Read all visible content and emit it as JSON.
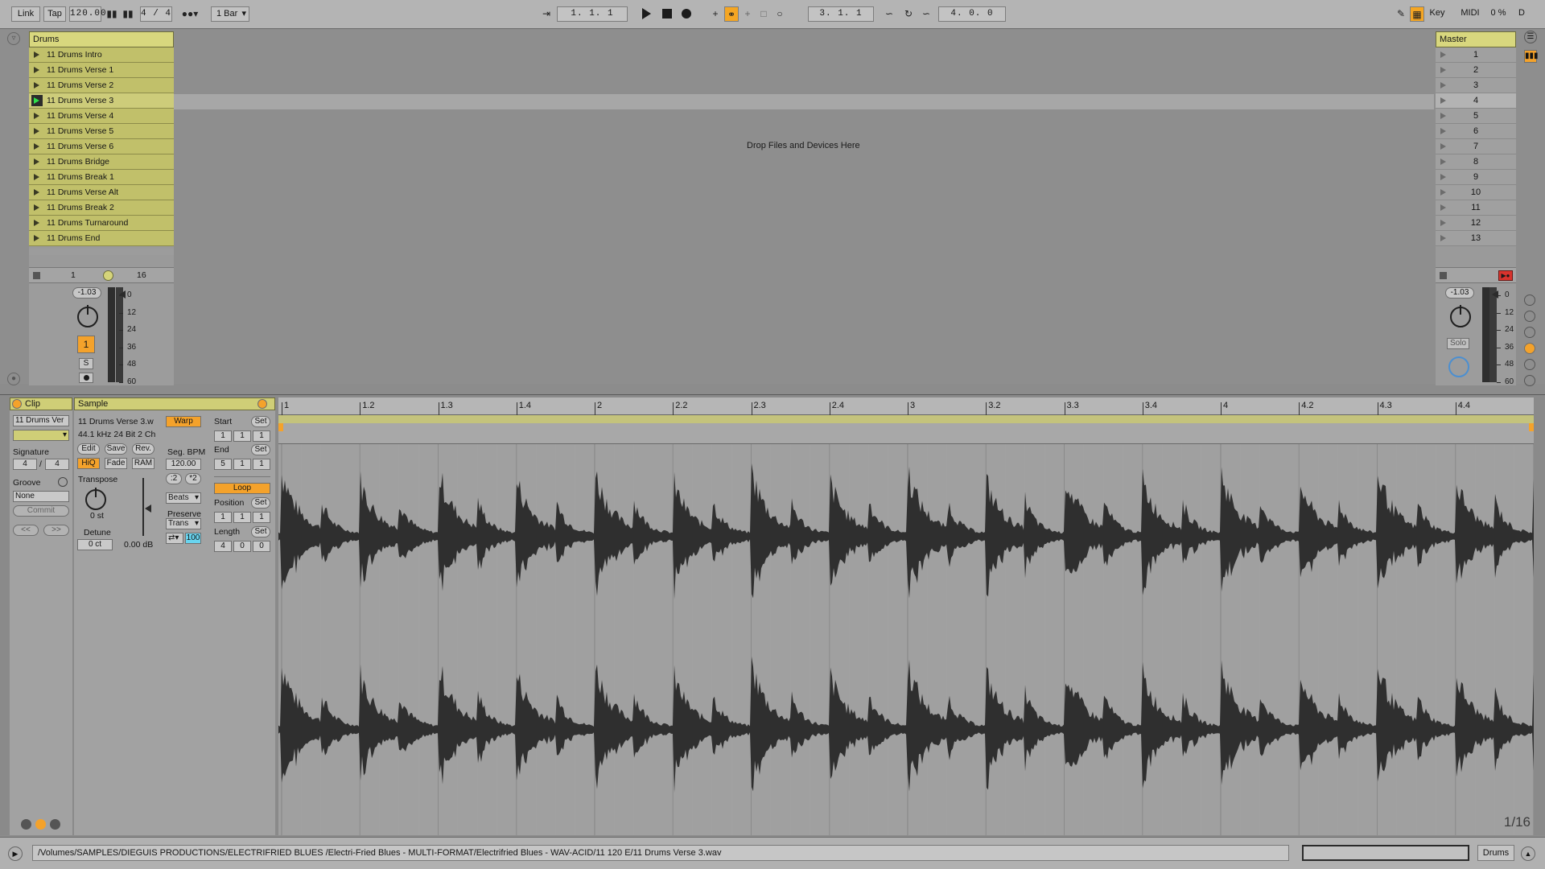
{
  "topbar": {
    "link": "Link",
    "tap": "Tap",
    "tempo": "120.00",
    "time_signature": "4 / 4",
    "quantization": "1 Bar",
    "arrangement_position": "1.  1.  1",
    "loop_start": "3.  1.  1",
    "loop_length": "4.  0.  0",
    "key": "Key",
    "midi": "MIDI",
    "cpu": "0 %",
    "disk": "D"
  },
  "session": {
    "drop_text": "Drop Files and Devices Here",
    "track": {
      "name": "Drums",
      "clips": [
        "11 Drums Intro",
        "11 Drums Verse 1",
        "11 Drums Verse 2",
        "11 Drums Verse 3",
        "11 Drums Verse 4",
        "11 Drums Verse 5",
        "11 Drums Verse 6",
        "11 Drums Bridge",
        "11 Drums Break 1",
        "11 Drums Verse Alt",
        "11 Drums Break 2",
        "11 Drums Turnaround",
        "11 Drums End"
      ],
      "playing_index": 3,
      "io_left": "1",
      "io_right": "16",
      "volume": "-1.03",
      "track_number": "1",
      "solo": "S",
      "meter_scale": [
        "0",
        "12",
        "24",
        "36",
        "48",
        "60"
      ]
    },
    "master": {
      "name": "Master",
      "scenes": [
        "1",
        "2",
        "3",
        "4",
        "5",
        "6",
        "7",
        "8",
        "9",
        "10",
        "11",
        "12",
        "13"
      ],
      "selected_scene_index": 3,
      "volume": "-1.03",
      "solo": "Solo",
      "meter_scale": [
        "0",
        "12",
        "24",
        "36",
        "48",
        "60"
      ]
    }
  },
  "clip_panel": {
    "header": "Clip",
    "clip_name": "11 Drums Ver",
    "signature_label": "Signature",
    "sig_num": "4",
    "sig_sep": "/",
    "sig_den": "4",
    "groove_label": "Groove",
    "groove_value": "None",
    "commit": "Commit",
    "prev": "<<",
    "next": ">>"
  },
  "sample_panel": {
    "header": "Sample",
    "file_name": "11 Drums Verse 3.w",
    "file_info": "44.1 kHz 24 Bit 2 Ch",
    "edit": "Edit",
    "save": "Save",
    "rev": "Rev.",
    "hiq": "HiQ",
    "fade": "Fade",
    "ram": "RAM",
    "transpose_label": "Transpose",
    "transpose_value": "0 st",
    "detune_label": "Detune",
    "detune_value": "0 ct",
    "gain_value": "0.00 dB",
    "warp": "Warp",
    "seg_bpm_label": "Seg. BPM",
    "seg_bpm": "120.00",
    "half": ":2",
    "double": "*2",
    "warp_mode": "Beats",
    "preserve_label": "Preserve",
    "preserve_value": "Trans",
    "loop_value": "100",
    "start_label": "Start",
    "start_set": "Set",
    "start_values": [
      "1",
      "1",
      "1"
    ],
    "end_label": "End",
    "end_set": "Set",
    "end_values": [
      "5",
      "1",
      "1"
    ],
    "loop": "Loop",
    "position_label": "Position",
    "position_set": "Set",
    "position_values": [
      "1",
      "1",
      "1"
    ],
    "length_label": "Length",
    "length_set": "Set",
    "length_values": [
      "4",
      "0",
      "0"
    ]
  },
  "ruler": {
    "labels": [
      "1",
      "1.2",
      "1.3",
      "1.4",
      "2",
      "2.2",
      "2.3",
      "2.4",
      "3",
      "3.2",
      "3.3",
      "3.4",
      "4",
      "4.2",
      "4.3",
      "4.4"
    ]
  },
  "zoom": "1/16",
  "status": {
    "path": "/Volumes/SAMPLES/DIEGUIS PRODUCTIONS/ELECTRIFRIED BLUES /Electri-Fried Blues - MULTI-FORMAT/Electrifried Blues - WAV-ACID/11 120 E/11 Drums Verse 3.wav",
    "track_tag": "Drums"
  },
  "colors": {
    "clip": "#c1c06a",
    "accent_orange": "#f4a22b",
    "play_green": "#2ee04a"
  }
}
